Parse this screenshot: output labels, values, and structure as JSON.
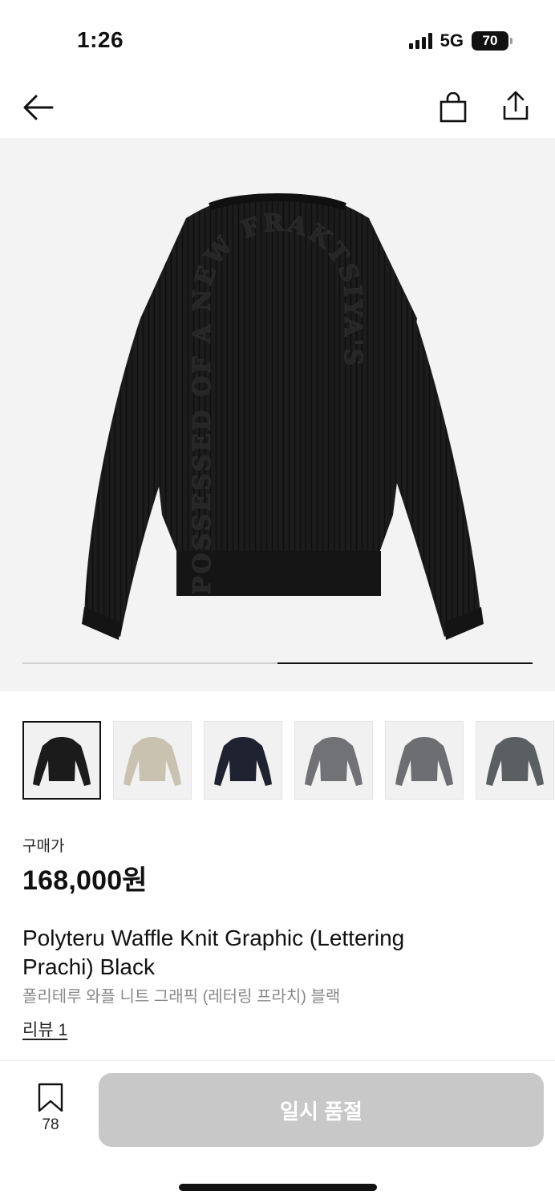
{
  "status_bar": {
    "time": "1:26",
    "network": "5G",
    "battery": "70"
  },
  "nav": {
    "back_icon": "arrow-left-icon",
    "bag_icon": "shopping-bag-icon",
    "share_icon": "share-upload-icon"
  },
  "hero": {
    "image_subject": "black waffle knit sweater, back view, arched lettering",
    "lettering": "POSSESSED OF A NEW FRAKTSIYA'S",
    "carousel_progress": 0.5
  },
  "thumbnails": [
    {
      "name": "black",
      "color": "#1b1b1b",
      "active": true
    },
    {
      "name": "beige",
      "color": "#c9c2b1",
      "active": false
    },
    {
      "name": "navy",
      "color": "#1f2230",
      "active": false
    },
    {
      "name": "grey",
      "color": "#707276",
      "active": false
    },
    {
      "name": "grey-print",
      "color": "#6d6e72",
      "active": false
    },
    {
      "name": "charcoal",
      "color": "#5a5f62",
      "active": false
    }
  ],
  "product": {
    "price_label": "구매가",
    "price": "168,000원",
    "title_en": "Polyteru Waffle Knit Graphic (Lettering Prachi) Black",
    "title_ko": "폴리테루 와플 니트 그래픽 (레터링 프라치) 블랙",
    "review_link": "리뷰 1"
  },
  "bottom_bar": {
    "bookmark_icon": "bookmark-icon",
    "bookmark_count": "78",
    "soldout_label": "일시 품절"
  }
}
